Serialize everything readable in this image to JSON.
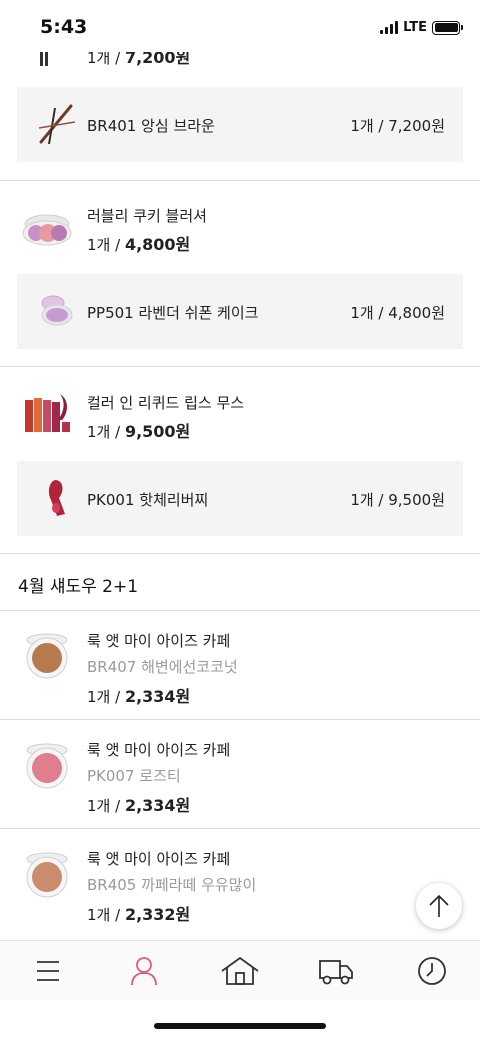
{
  "status_bar": {
    "time": "5:43",
    "network": "LTE"
  },
  "partial_item": {
    "qty": "1개 / ",
    "price": "7,200원"
  },
  "groups": [
    {
      "product": null,
      "option": {
        "name": "BR401 앙심 브라운",
        "price": "1개 / 7,200원"
      }
    },
    {
      "product": {
        "name": "러블리 쿠키 블러셔",
        "qty": "1개 / ",
        "price": "4,800원"
      },
      "option": {
        "name": "PP501 라벤더 쉬폰 케이크",
        "price": "1개 / 4,800원"
      }
    },
    {
      "product": {
        "name": "컬러 인 리퀴드 립스 무스",
        "qty": "1개 / ",
        "price": "9,500원"
      },
      "option": {
        "name": "PK001 핫체리버찌",
        "price": "1개 / 9,500원"
      }
    }
  ],
  "section": {
    "title": "4월 섀도우 2+1"
  },
  "shadow_items": [
    {
      "name": "룩 앳 마이 아이즈 카페",
      "option": "BR407 해변에선코코넛",
      "qty": "1개 / ",
      "price": "2,334원",
      "color": "#b67a4c"
    },
    {
      "name": "룩 앳 마이 아이즈 카페",
      "option": "PK007 로즈티",
      "qty": "1개 / ",
      "price": "2,334원",
      "color": "#e07e8e"
    },
    {
      "name": "룩 앳 마이 아이즈 카페",
      "option": "BR405 까페라떼 우유많이",
      "qty": "1개 / ",
      "price": "2,332원",
      "color": "#c98c6e"
    }
  ],
  "tab_bar": {
    "items": [
      "menu-icon",
      "user-icon",
      "home-icon",
      "delivery-truck-icon",
      "recent-clock-icon"
    ]
  },
  "colors": {
    "accent": "#e05a7b",
    "box_bg": "#f4f4f4",
    "muted_text": "#9a9a9a",
    "divider": "#dcdcdc"
  }
}
